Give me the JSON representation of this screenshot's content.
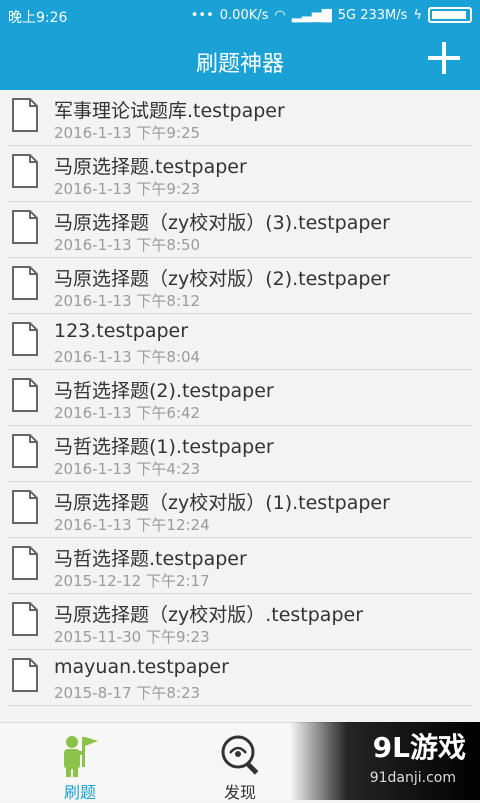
{
  "status": {
    "time": "晚上9:26",
    "network": "0.00K/s",
    "signal": "5G 233M/s"
  },
  "appbar": {
    "title": "刷题神器",
    "add_icon": "plus-icon"
  },
  "files": [
    {
      "name": "军事理论试题库.testpaper",
      "date": "2016-1-13  下午9:25"
    },
    {
      "name": "马原选择题.testpaper",
      "date": "2016-1-13  下午9:23"
    },
    {
      "name": "马原选择题（zy校对版）(3).testpaper",
      "date": "2016-1-13  下午8:50"
    },
    {
      "name": "马原选择题（zy校对版）(2).testpaper",
      "date": "2016-1-13  下午8:12"
    },
    {
      "name": "123.testpaper",
      "date": "2016-1-13  下午8:04"
    },
    {
      "name": "马哲选择题(2).testpaper",
      "date": "2016-1-13  下午6:42"
    },
    {
      "name": "马哲选择题(1).testpaper",
      "date": "2016-1-13  下午4:23"
    },
    {
      "name": "马原选择题（zy校对版）(1).testpaper",
      "date": "2016-1-13  下午12:24"
    },
    {
      "name": "马哲选择题.testpaper",
      "date": "2015-12-12  下午2:17"
    },
    {
      "name": "马原选择题（zy校对版）.testpaper",
      "date": "2015-11-30  下午9:23"
    },
    {
      "name": "mayuan.testpaper",
      "date": "2015-8-17  下午8:23"
    }
  ],
  "tabs": [
    {
      "label": "刷题",
      "icon": "practice-icon",
      "active": true
    },
    {
      "label": "发现",
      "icon": "discover-icon",
      "active": false
    }
  ],
  "watermark": {
    "logo": "9L游戏",
    "site": "91danji.com"
  },
  "colors": {
    "primary": "#1aa1d6",
    "active_tab": "#1aa1d6",
    "icon_green": "#8bc34a"
  }
}
